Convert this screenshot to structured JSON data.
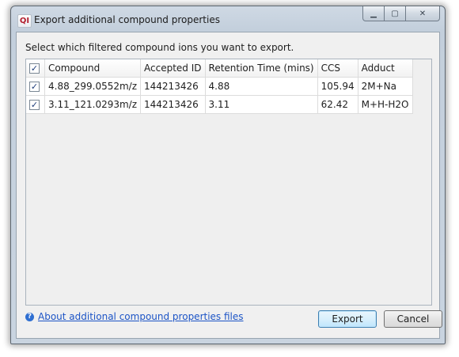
{
  "window": {
    "app_icon": "QI",
    "title": "Export additional compound properties",
    "controls": {
      "minimize": "▁",
      "maximize": "▢",
      "close": "✕"
    }
  },
  "prompt": "Select which filtered compound ions you want to export.",
  "table": {
    "headers": [
      "Compound",
      "Accepted ID",
      "Retention Time (mins)",
      "CCS",
      "Adduct"
    ],
    "rows": [
      {
        "checked": true,
        "compound": "4.88_299.0552m/z",
        "accepted_id": "144213426",
        "retention_time": "4.88",
        "ccs": "105.94",
        "adduct": "2M+Na"
      },
      {
        "checked": true,
        "compound": "3.11_121.0293m/z",
        "accepted_id": "144213426",
        "retention_time": "3.11",
        "ccs": "62.42",
        "adduct": "M+H-H2O"
      }
    ],
    "header_checked": true
  },
  "help_link": {
    "icon": "help-icon",
    "label": "About additional compound properties files"
  },
  "buttons": {
    "export": "Export",
    "cancel": "Cancel"
  }
}
